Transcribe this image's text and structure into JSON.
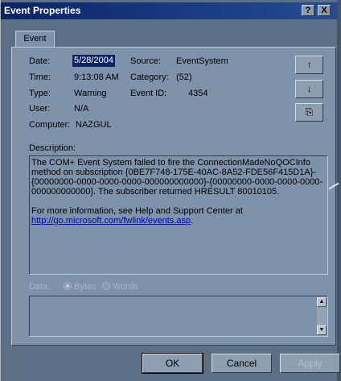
{
  "window": {
    "title": "Event Properties",
    "help_btn": "?",
    "close_btn": "X"
  },
  "tabs": [
    {
      "label": "Event"
    }
  ],
  "fields": {
    "date_label": "Date:",
    "date_value": "5/28/2004",
    "time_label": "Time:",
    "time_value": "9:13:08 AM",
    "type_label": "Type:",
    "type_value": "Warning",
    "user_label": "User:",
    "user_value": "N/A",
    "computer_label": "Computer:",
    "computer_value": "NAZGUL",
    "source_label": "Source:",
    "source_value": "EventSystem",
    "category_label": "Category:",
    "category_value": "(52)",
    "eventid_label": "Event ID:",
    "eventid_value": "4354"
  },
  "nav_buttons": {
    "up": "↑",
    "down": "↓",
    "copy": "⎘"
  },
  "description": {
    "label": "Description:",
    "paragraph": "The COM+ Event System failed to fire the ConnectionMadeNoQOCInfo method on subscription {0BE7F748-175E-40AC-8A52-FDE56F415D1A}-{00000000-0000-0000-0000-000000000000}-{00000000-0000-0000-0000-000000000000}. The subscriber returned HRESULT 80010105.",
    "more_info": "For more information, see Help and Support Center at",
    "link": "http://go.microsoft.com/fwlink/events.asp",
    "link_suffix": "."
  },
  "data_section": {
    "label": "Data:",
    "bytes_label": "Bytes",
    "words_label": "Words",
    "selected": "Bytes"
  },
  "buttons": {
    "ok": "OK",
    "cancel": "Cancel",
    "apply": "Apply"
  }
}
